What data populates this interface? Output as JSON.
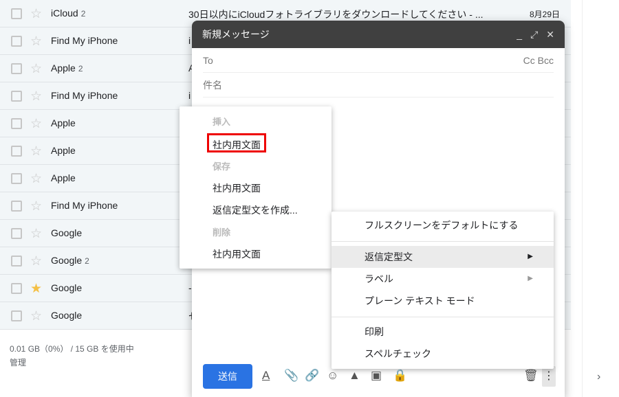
{
  "emails": [
    {
      "sender": "iCloud",
      "count": "2",
      "subject": "30日以内にiCloudフォトライブラリをダウンロードしてください - ...",
      "date": "8月29日",
      "starred": false
    },
    {
      "sender": "Find My iPhone",
      "count": "",
      "subject": "i",
      "date": "",
      "starred": false
    },
    {
      "sender": "Apple",
      "count": "2",
      "subject": "A",
      "date": "",
      "starred": false
    },
    {
      "sender": "Find My iPhone",
      "count": "",
      "subject": "i",
      "date": "",
      "starred": false
    },
    {
      "sender": "Apple",
      "count": "",
      "subject": "",
      "date": "",
      "starred": false
    },
    {
      "sender": "Apple",
      "count": "",
      "subject": "",
      "date": "",
      "starred": false
    },
    {
      "sender": "Apple",
      "count": "",
      "subject": "",
      "date": "",
      "starred": false
    },
    {
      "sender": "Find My iPhone",
      "count": "",
      "subject": "",
      "date": "",
      "starred": false
    },
    {
      "sender": "Google",
      "count": "",
      "subject": "",
      "date": "",
      "starred": false
    },
    {
      "sender": "Google",
      "count": "2",
      "subject": "",
      "date": "",
      "starred": false
    },
    {
      "sender": "Google",
      "count": "",
      "subject": "-",
      "date": "",
      "starred": true
    },
    {
      "sender": "Google",
      "count": "",
      "subject": "セ",
      "date": "",
      "starred": false
    }
  ],
  "storage": {
    "usage": "0.01 GB（0%） / 15 GB を使用中",
    "manage": "管理"
  },
  "compose": {
    "title": "新規メッセージ",
    "to": "To",
    "ccbcc": "Cc Bcc",
    "subject": "件名",
    "send": "送信"
  },
  "template_menu": {
    "insert_header": "挿入",
    "insert_item": "社内用文面",
    "save_header": "保存",
    "save_item": "社内用文面",
    "create": "返信定型文を作成...",
    "delete_header": "削除",
    "delete_item": "社内用文面"
  },
  "more_menu": {
    "fullscreen": "フルスクリーンをデフォルトにする",
    "templates": "返信定型文",
    "label": "ラベル",
    "plaintext": "プレーン テキスト モード",
    "print": "印刷",
    "spellcheck": "スペルチェック"
  },
  "colors": {
    "send": "#2a73e3",
    "highlight": "#e00000",
    "star": "#f4c046"
  }
}
